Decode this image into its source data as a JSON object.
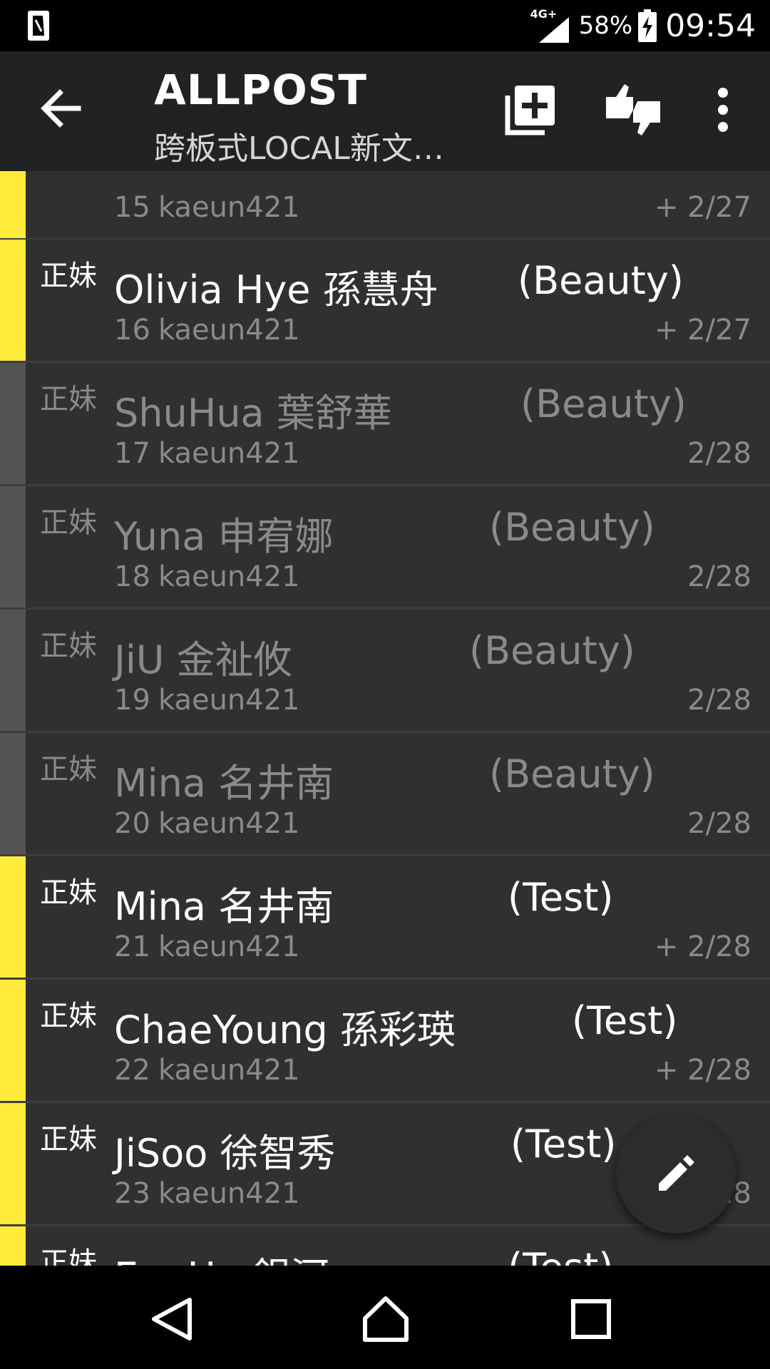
{
  "status_bar": {
    "network": "4G+",
    "battery_percent": "58%",
    "time": "09:54"
  },
  "toolbar": {
    "title": "ALLPOST",
    "subtitle": "跨板式LOCAL新文…",
    "icons": [
      "back-arrow-icon",
      "add-to-queue-icon",
      "thumbs-up-down-icon",
      "more-vert-icon"
    ]
  },
  "posts": [
    {
      "tag": "",
      "title": "",
      "category": "",
      "number": "15",
      "author": "kaeun421",
      "date": "+ 2/27",
      "read": false
    },
    {
      "tag": "正妹",
      "title": "Olivia Hye 孫慧舟",
      "category": "(Beauty)",
      "number": "16",
      "author": "kaeun421",
      "date": "+ 2/27",
      "read": false
    },
    {
      "tag": "正妹",
      "title": "ShuHua 葉舒華",
      "category": "(Beauty)",
      "number": "17",
      "author": "kaeun421",
      "date": "2/28",
      "read": true
    },
    {
      "tag": "正妹",
      "title": "Yuna 申宥娜",
      "category": "(Beauty)",
      "number": "18",
      "author": "kaeun421",
      "date": "2/28",
      "read": true
    },
    {
      "tag": "正妹",
      "title": "JiU 金祉攸",
      "category": "(Beauty)",
      "number": "19",
      "author": "kaeun421",
      "date": "2/28",
      "read": true
    },
    {
      "tag": "正妹",
      "title": "Mina 名井南",
      "category": "(Beauty)",
      "number": "20",
      "author": "kaeun421",
      "date": "2/28",
      "read": true
    },
    {
      "tag": "正妹",
      "title": "Mina 名井南",
      "category": "(Test)",
      "number": "21",
      "author": "kaeun421",
      "date": "+ 2/28",
      "read": false
    },
    {
      "tag": "正妹",
      "title": "ChaeYoung 孫彩瑛",
      "category": "(Test)",
      "number": "22",
      "author": "kaeun421",
      "date": "+ 2/28",
      "read": false
    },
    {
      "tag": "正妹",
      "title": "JiSoo 徐智秀",
      "category": "(Test)",
      "number": "23",
      "author": "kaeun421",
      "date": "+ 2/28",
      "read": false
    },
    {
      "tag": "正妹",
      "title": "EunHa 銀河",
      "category": "(Test)",
      "number": "",
      "author": "",
      "date": "",
      "read": false
    }
  ],
  "fab": {
    "icon": "pencil-icon"
  },
  "nav_bar": {
    "icons": [
      "back-triangle-icon",
      "home-icon",
      "recents-icon"
    ]
  }
}
